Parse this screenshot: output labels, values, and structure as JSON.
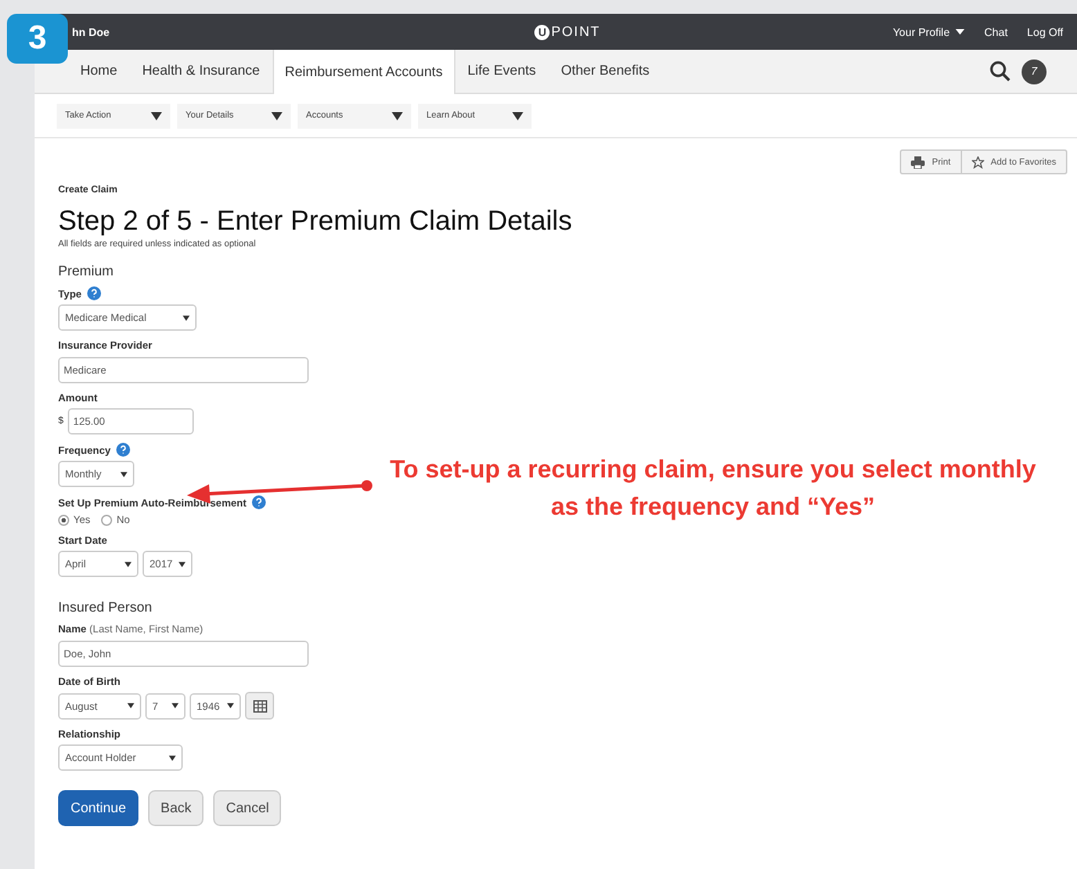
{
  "badge": "3",
  "header": {
    "user": "hn Doe",
    "logo": "POINT",
    "logo_mark": "U",
    "links": [
      {
        "label": "Your Profile",
        "caret": true
      },
      {
        "label": "Chat",
        "caret": false
      },
      {
        "label": "Log Off",
        "caret": false
      }
    ],
    "avatar": "7"
  },
  "tabs": [
    {
      "label": "Home",
      "selected": false
    },
    {
      "label": "Health & Insurance",
      "selected": false
    },
    {
      "label": "Reimbursement Accounts",
      "selected": true
    },
    {
      "label": "Life Events",
      "selected": false
    },
    {
      "label": "Other Benefits",
      "selected": false
    }
  ],
  "subnav": [
    "Take Action",
    "Your Details",
    "Accounts",
    "Learn About"
  ],
  "tools": [
    {
      "label": "Print",
      "kind": "print"
    },
    {
      "label": "Add to Favorites",
      "kind": "star"
    }
  ],
  "breadcrumb": "Create Claim",
  "title": "Step 2 of 5 - Enter Premium Claim Details",
  "subtitle": "All fields are required unless indicated as optional",
  "sections": [
    {
      "heading": "Premium",
      "fields": [
        {
          "kind": "select",
          "label": "Type",
          "help": true,
          "values": [
            "Medicare Medical"
          ]
        },
        {
          "kind": "text",
          "label": "Insurance Provider",
          "value": "Medicare"
        },
        {
          "kind": "amount",
          "label": "Amount",
          "prefix": "$",
          "value": "125.00"
        },
        {
          "kind": "select",
          "label": "Frequency",
          "help": true,
          "values": [
            "Monthly"
          ]
        },
        {
          "kind": "radio",
          "label": "Set Up Premium Auto-Reimbursement",
          "help": true,
          "options": [
            {
              "label": "Yes",
              "selected": true
            },
            {
              "label": "No",
              "selected": false
            }
          ]
        },
        {
          "kind": "select",
          "label": "Start Date",
          "values": [
            "April",
            "2017"
          ]
        }
      ]
    },
    {
      "heading": "Insured Person",
      "fields": [
        {
          "kind": "text",
          "label": "Name",
          "note": "(Last Name, First Name)",
          "value": "Doe, John"
        },
        {
          "kind": "date",
          "label": "Date of Birth",
          "values": [
            "August",
            "7",
            "1946"
          ]
        },
        {
          "kind": "select",
          "label": "Relationship",
          "values": [
            "Account Holder"
          ]
        }
      ]
    }
  ],
  "buttons": [
    {
      "label": "Continue",
      "primary": true
    },
    {
      "label": "Back",
      "primary": false
    },
    {
      "label": "Cancel",
      "primary": false
    }
  ],
  "annotation": "To set-up a recurring claim, ensure you select monthly as the frequency and “Yes”"
}
